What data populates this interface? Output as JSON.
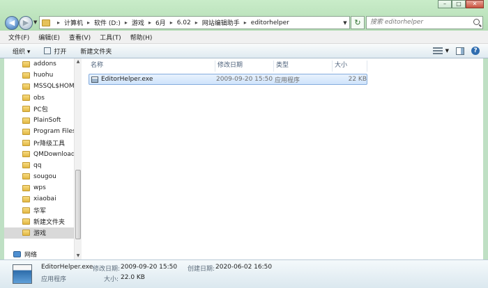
{
  "window": {
    "buttons": {
      "minimize": "–",
      "maximize": "□",
      "close": "✕"
    }
  },
  "address": {
    "crumbs": [
      "计算机",
      "软件 (D:)",
      "游戏",
      "6月",
      "6.02",
      "网站编辑助手",
      "editorhelper"
    ],
    "search_placeholder": "搜索 editorhelper"
  },
  "menu": {
    "items": [
      "文件(F)",
      "编辑(E)",
      "查看(V)",
      "工具(T)",
      "帮助(H)"
    ]
  },
  "toolbar": {
    "organize": "组织 ▾",
    "open": "打开",
    "new_folder": "新建文件夹"
  },
  "sidebar": {
    "folders": [
      "addons",
      "huohu",
      "MSSQL$HOM",
      "obs",
      "PC包",
      "PlainSoft",
      "Program Files",
      "Pr降级工具",
      "QMDownload",
      "qq",
      "sougou",
      "wps",
      "xiaobai",
      "华军",
      "新建文件夹",
      "游戏"
    ],
    "selected": "游戏",
    "network": "网络"
  },
  "columns": {
    "name": "名称",
    "date": "修改日期",
    "type": "类型",
    "size": "大小"
  },
  "files": [
    {
      "name": "EditorHelper.exe",
      "date": "2009-09-20 15:50",
      "type": "应用程序",
      "size": "22 KB"
    }
  ],
  "details": {
    "name": "EditorHelper.exe",
    "modified_label": "修改日期:",
    "modified_value": "2009-09-20 15:50",
    "created_label": "创建日期:",
    "created_value": "2020-06-02 16:50",
    "type": "应用程序",
    "size_label": "大小:",
    "size_value": "22.0 KB"
  }
}
